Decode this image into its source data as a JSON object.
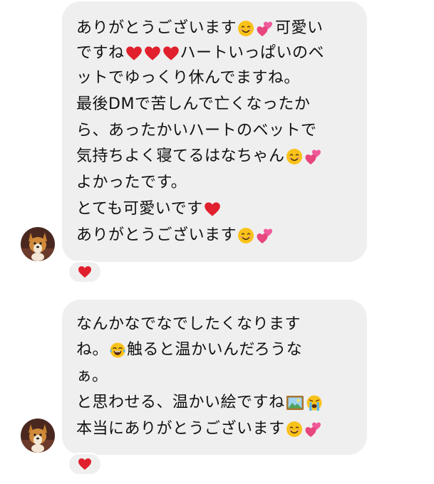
{
  "colors": {
    "bubble": "#efefef",
    "text": "#111111",
    "heart": "#e0202c",
    "pink_hearts": "#f05a9a",
    "smile": "#f9c21a"
  },
  "messages": [
    {
      "lines": [
        [
          {
            "t": "ありがとうございます"
          },
          {
            "e": "smile-icon"
          },
          {
            "e": "two-hearts-icon"
          },
          {
            "t": "可愛い"
          }
        ],
        [
          {
            "t": "ですね"
          },
          {
            "e": "red-heart-icon"
          },
          {
            "e": "red-heart-icon"
          },
          {
            "e": "red-heart-icon"
          },
          {
            "t": "ハートいっぱいのベ"
          }
        ],
        [
          {
            "t": "ットでゆっくり休んでますね。"
          }
        ],
        [
          {
            "t": "最後DMで苦しんで亡くなったか"
          }
        ],
        [
          {
            "t": "ら、あったかいハートのベットで"
          }
        ],
        [
          {
            "t": "気持ちよく寝てるはなちゃん"
          },
          {
            "e": "smile-icon"
          },
          {
            "e": "two-hearts-icon"
          }
        ],
        [
          {
            "t": "よかったです。"
          }
        ],
        [
          {
            "t": "とても可愛いです"
          },
          {
            "e": "red-heart-icon"
          }
        ],
        [
          {
            "t": "ありがとうございます"
          },
          {
            "e": "smile-icon"
          },
          {
            "e": "two-hearts-icon"
          }
        ]
      ],
      "reaction": "red-heart-icon"
    },
    {
      "lines": [
        [
          {
            "t": "なんかなでなでしたくなります"
          }
        ],
        [
          {
            "t": "ね。"
          },
          {
            "e": "tears-of-joy-icon"
          },
          {
            "t": "触ると温かいんだろうな"
          }
        ],
        [
          {
            "t": "ぁ。"
          }
        ],
        [
          {
            "t": "と思わせる、温かい絵ですね"
          },
          {
            "e": "framed-picture-icon"
          },
          {
            "e": "crying-face-icon"
          }
        ],
        [
          {
            "t": "本当にありがとうございます"
          },
          {
            "e": "smile-icon"
          },
          {
            "e": "two-hearts-icon"
          }
        ]
      ],
      "reaction": "red-heart-icon"
    }
  ]
}
